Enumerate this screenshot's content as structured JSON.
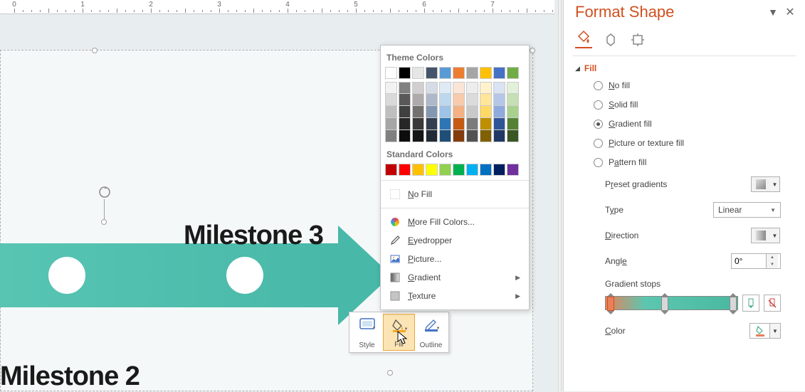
{
  "ruler": {
    "labels": [
      "0",
      "1",
      "2",
      "3",
      "4",
      "5",
      "6",
      "7"
    ]
  },
  "slide": {
    "milestone2": "Milestone 2",
    "milestone3": "Milestone 3"
  },
  "mini_toolbar": {
    "style": "Style",
    "fill": "Fill",
    "outline": "Outline"
  },
  "color_popup": {
    "theme_header": "Theme Colors",
    "standard_header": "Standard Colors",
    "theme_main": [
      "#ffffff",
      "#000000",
      "#e7e6e6",
      "#44546a",
      "#5b9bd5",
      "#ed7d31",
      "#a5a5a5",
      "#ffc000",
      "#4472c4",
      "#70ad47"
    ],
    "theme_shades": [
      [
        "#f2f2f2",
        "#d9d9d9",
        "#bfbfbf",
        "#a6a6a6",
        "#808080"
      ],
      [
        "#808080",
        "#595959",
        "#404040",
        "#262626",
        "#0d0d0d"
      ],
      [
        "#d0cece",
        "#aeaaaa",
        "#767171",
        "#3b3838",
        "#161616"
      ],
      [
        "#d6dce5",
        "#adb9ca",
        "#8497b0",
        "#333f50",
        "#222a35"
      ],
      [
        "#deebf7",
        "#bdd7ee",
        "#9dc3e6",
        "#2e75b6",
        "#1f4e79"
      ],
      [
        "#fbe5d6",
        "#f8cbad",
        "#f4b183",
        "#c55a11",
        "#843c0c"
      ],
      [
        "#ededed",
        "#dbdbdb",
        "#c9c9c9",
        "#7b7b7b",
        "#525252"
      ],
      [
        "#fff2cc",
        "#ffe699",
        "#ffd966",
        "#bf8f00",
        "#806000"
      ],
      [
        "#dae3f3",
        "#b4c7e7",
        "#8faadc",
        "#2f5597",
        "#203864"
      ],
      [
        "#e2f0d9",
        "#c5e0b4",
        "#a9d18e",
        "#548235",
        "#385723"
      ]
    ],
    "standard": [
      "#c00000",
      "#ff0000",
      "#ffc000",
      "#ffff00",
      "#92d050",
      "#00b050",
      "#00b0f0",
      "#0070c0",
      "#002060",
      "#7030a0"
    ],
    "no_fill": "No Fill",
    "more_colors": "More Fill Colors...",
    "eyedropper": "Eyedropper",
    "picture": "Picture...",
    "gradient": "Gradient",
    "texture": "Texture"
  },
  "panel": {
    "title": "Format Shape",
    "section_fill": "Fill",
    "radios": {
      "none": "No fill",
      "solid": "Solid fill",
      "gradient": "Gradient fill",
      "picture": "Picture or texture fill",
      "pattern": "Pattern fill"
    },
    "preset": "Preset gradients",
    "type": "Type",
    "type_value": "Linear",
    "direction": "Direction",
    "angle": "Angle",
    "angle_value": "0°",
    "gradient_stops": "Gradient stops",
    "color": "Color"
  }
}
